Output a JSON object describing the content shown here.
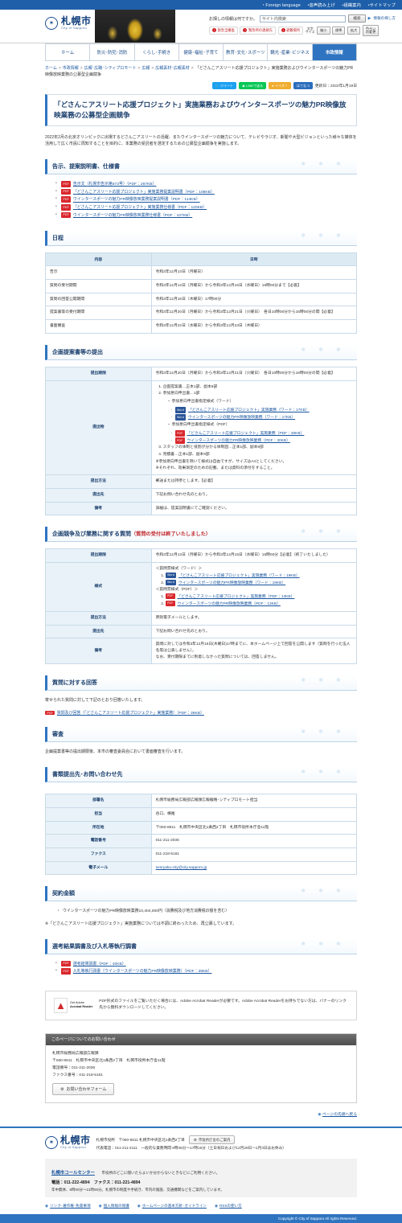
{
  "utilbar": {
    "links": [
      "Foreign language",
      "音声読み上げ",
      "組織案内",
      "サイトマップ"
    ]
  },
  "header": {
    "logo_jp": "札幌市",
    "logo_en": "City of Sapporo",
    "logo_mark": "star-crest-icon",
    "search_label": "お探しの情報は何ですか。",
    "search_placeholder": "サイト内検索",
    "search_value": "サイト内検索",
    "search_button": "検索",
    "help_link": "情報の探し方",
    "emergency": [
      "救急当番医",
      "緊急時の連絡先",
      "避難場所"
    ],
    "fontsize_label": "文字\nサイズ",
    "fontsize_label_1": "文字",
    "fontsize_label_2": "サイズ",
    "fontsize_buttons": [
      "縮小",
      "標準",
      "拡大"
    ],
    "color_button_1": "色合い",
    "color_button_2": "の変更"
  },
  "gnav": [
    {
      "label": "ホーム",
      "active": false
    },
    {
      "label": "防災･防犯･消防",
      "active": false
    },
    {
      "label": "くらし･手続き",
      "active": false
    },
    {
      "label": "健康･福祉･子育て",
      "active": false
    },
    {
      "label": "教育･文化･スポーツ",
      "active": false
    },
    {
      "label": "観光･産業･ビジネス",
      "active": false
    },
    {
      "label": "市政情報",
      "active": true
    }
  ],
  "breadcrumb": {
    "items": [
      "ホーム",
      "市政情報",
      "広報･広聴･シティプロモート",
      "広報",
      "広報素材･広報素材"
    ],
    "current": "「どさんこアスリート応援プロジェクト」実施業務およびウインタースポーツの魅力PR映像放映業務の公募型企画競争"
  },
  "share": {
    "twitter": "ツイート",
    "line": "LINEで送る",
    "nice": "イイネ！",
    "hatena": "はてな",
    "hatena_count": "0",
    "updated": "更新日：2022年1月19日"
  },
  "page": {
    "title": "「どさんこアスリート応援プロジェクト」実施業務およびウインタースポーツの魅力PR映像放映業務の公募型企画競争",
    "lede": "2022年2月の北京オリンピックに出場するどさんこアスリートの活躍、またウインタースポーツの魅力について、テレビやラジオ、新聞や大型ビジョンといった様々な媒体を活用して広く市民に周知することを目的に、本業務の受託者を選定するための公募型企画競争を実施します。"
  },
  "sections": {
    "docs": {
      "heading": "告示、提案説明書、仕様書",
      "links": [
        {
          "tag": "PDF",
          "text": "告示文（札幌市告示第673号）（PDF：267KB）"
        },
        {
          "tag": "PDF",
          "text": "「どさんこアスリート応援プロジェクト」実施業務提案説明書（PDF：108KB）"
        },
        {
          "tag": "PDF",
          "text": "ウインタースポーツの魅力PR映像放映業務提案説明書（PDF：114KB）"
        },
        {
          "tag": "PDF",
          "text": "「どさんこアスリート応援プロジェクト」実施業務仕様書（PDF：120KB）"
        },
        {
          "tag": "PDF",
          "text": "ウインタースポーツの魅力PR映像放映業務仕様書（PDF：107KB）"
        }
      ]
    },
    "schedule": {
      "heading": "日程",
      "columns": [
        "内容",
        "日時"
      ],
      "rows": [
        [
          "告示",
          "令和3年12月13日（月曜日）"
        ],
        [
          "質問の受付期間",
          "令和3年12月13日（月曜日）から令和3年12月15日（水曜日）16時00分まで【必着】"
        ],
        [
          "質問の回答公開期間",
          "令和3年12月16日（木曜日）17時00分"
        ],
        [
          "提案書等の受付期間",
          "令和3年12月20日（月曜日）から令和3年12月21日（火曜日）　各日10時00分から16時00分の間【必着】"
        ],
        [
          "書面審査",
          "令和3年12月22日（水曜日）から令和3年12月23日（木曜日）"
        ]
      ]
    },
    "submission": {
      "heading": "企画提案書等の提出",
      "deadline_label": "提出期限",
      "deadline_value": "令和3年12月20日（月曜日）から令和3年12月21日（火曜日）　各日10時00分から16時00分の間【必着】",
      "items_label": "提出物",
      "items_ordered": [
        "企画提案書…正本1部、副本9部",
        "参加意向申出書…1部"
      ],
      "word_group_label": "参加意向申出書指定様式（ワード）",
      "word_links": [
        {
          "tag": "Word",
          "text": "「どさんこアスリート応援プロジェクト」実施業務（ワード：17KB）"
        },
        {
          "tag": "Word",
          "text": "ウインタースポーツの魅力PR映像放映業務（ワード：17KB）"
        }
      ],
      "pdf_group_label": "参加意向申出書指定様式（PDF）",
      "pdf_links": [
        {
          "tag": "PDF",
          "text": "「どさんこアスリート応援プロジェクト」実施業務（PDF：30KB）"
        },
        {
          "tag": "PDF",
          "text": "ウインタースポーツの魅力PR映像放映業務（PDF：30KB）"
        }
      ],
      "items_ordered2": [
        "スタッフの体制と役割が分かる体制図…正本1部、副本9部",
        "見積書…正本1部、副本9部"
      ],
      "notes": [
        "※参加意向申出書を除いて様式は自由ですが、サイズはA4としてください。",
        "※それぞれ、効果測定のための記載、または資料の添付をすること。"
      ],
      "method_label": "提出方法",
      "method_value": "郵送または持参とします。【必着】",
      "dest_label": "提出先",
      "dest_value": "下記お問い合わせ先のとおり。",
      "remarks_label": "備考",
      "remarks_value": "詳細は、提案説明書にてご確認ください。"
    },
    "questions": {
      "heading_main": "企画競争及び業務に関する質問",
      "heading_sub": "（質問の受付は終了いたしました）",
      "deadline_label": "提出期限",
      "deadline_value": "令和3年12月13日（月曜日）から令和3年12月15日（水曜日）16時00分【必着】（終了いたしました）",
      "form_label": "様式",
      "word_group_label": "＜質問票様式（ワード）＞",
      "word_links": [
        {
          "tag": "Word",
          "text": "「どさんこアスリート応援プロジェクト」実施業務（ワード：19KB）"
        },
        {
          "tag": "Word",
          "text": "ウインタースポーツの魅力PR映像放映業務（ワード：19KB）"
        }
      ],
      "pdf_group_label": "＜質問票様式（PDF）＞",
      "pdf_links": [
        {
          "tag": "PDF",
          "text": "「どさんこアスリート応援プロジェクト」実施業務（PDF：13KB）"
        },
        {
          "tag": "PDF",
          "text": "ウインタースポーツの魅力PR映像放映業務（PDF：13KB）"
        }
      ],
      "method_label": "提出方法",
      "method_value": "原則電子メールとします。",
      "dest_label": "提出先",
      "dest_value": "下記お問い合わせ先のとおり。",
      "remarks_label": "備考",
      "remarks_value_1": "質問に対しては令和3年12月16日(木曜日)17時までに、本ホームページ上で回答を公開します（質問を行った法人名等は公表しません）。",
      "remarks_value_2": "なお、受付期限までに到着しなかった質問については、回答しません。"
    },
    "answers": {
      "heading": "質問に対する回答",
      "para": "寄せられた質問に対して下記のとおり回答いたします。",
      "links": [
        {
          "tag": "PDF",
          "text": "質問及び回答（「どさんこアスリート応援プロジェクト」実施業務）（PDF：39KB）"
        }
      ]
    },
    "review": {
      "heading": "審査",
      "para": "企画提案書等の提出期限後、本市の審査委員会において書面審査を行います。"
    },
    "contact": {
      "heading": "書類提出先･お問い合わせ先",
      "rows": [
        [
          "部署名",
          "札幌市総務局広報部広報課広報戦略･シティプロモート担当"
        ],
        [
          "担当",
          "谷口、横尾"
        ],
        [
          "所在地",
          "〒060-8611　札幌市中央区北1条西2丁目　札幌市役所本庁舎11階"
        ],
        [
          "電話番号",
          "011-211-2036"
        ],
        [
          "ファクス",
          "011-218-5161"
        ]
      ],
      "email_label": "電子メール",
      "email_value": "senryaku-city@city.sapporo.jp"
    },
    "amount": {
      "heading": "契約金額",
      "bullets": [
        "ウインタースポーツの魅力PR映像放映業務10,404,000円（消費税及び地方消費税の額を含む）"
      ],
      "note": "※「どさんこアスリート応援プロジェクト」実施業務については不調に終わったため、再公募しています。"
    },
    "results": {
      "heading": "選考結果調書及び入札等執行調書",
      "links": [
        {
          "tag": "PDF",
          "text": "選考結果調書（PDF：40KB）"
        },
        {
          "tag": "PDF",
          "text": "入札等執行調書（ウインタースポーツの魅力PR映像放映業務）（PDF：39KB）"
        }
      ]
    }
  },
  "acrobat": {
    "badge_line1": "Get Adobe",
    "badge_line2": "Acrobat Reader",
    "icon": "adobe-acrobat-icon",
    "text": "PDF形式のファイルをご覧いただく場合には、Adobe Acrobat Readerが必要です。Adobe Acrobat Readerをお持ちでない方は、バナーのリンク先から無料ダウンロードしてください。"
  },
  "page_contact": {
    "heading": "このページについてのお問い合わせ",
    "dept": "札幌市総務局広報部広報課",
    "addr": "〒060-8611　札幌市中央区北1条西2丁目　札幌市役所本庁舎11階",
    "tel": "電話番号：011-211-2036",
    "fax": "ファクス番号：011-218-5161",
    "button": "お問い合わせフォーム",
    "button_icon": "gear-icon"
  },
  "totop": {
    "label": "ページの先頭へ戻る",
    "icon": "arrow-up-icon"
  },
  "footer": {
    "logo_jp": "札幌市",
    "logo_en": "City of Sapporo",
    "office": "札幌市役所　〒060-8611 札幌市中央区北1条西2丁目",
    "guide_button": "市役所庁舎のご案内",
    "hours": "代表電話：011-211-2111　一般的な業務時間 8時45分～17時15分（土日祝日および12月29日～1月3日はお休み）",
    "callcenter_title": "札幌市コールセンター",
    "callcenter_sub": "市役所のどこに聞いたらよいか分からないときなどにご利用ください。",
    "callcenter_number": "電話：011-222-4894　ファクス：011-221-4894",
    "callcenter_detail": "年中無休、8時00分～21時00分。札幌市の制度や手続き、市内の施設、交通機関などをご案内しています。",
    "links": [
      "リンク･著作権･免責事項",
      "個人情報の保護",
      "ホームページの基本方針･ガイドライン",
      "RSSの使い方"
    ],
    "copyright": "Copyright © City of Sapporo All rights Reserved."
  }
}
